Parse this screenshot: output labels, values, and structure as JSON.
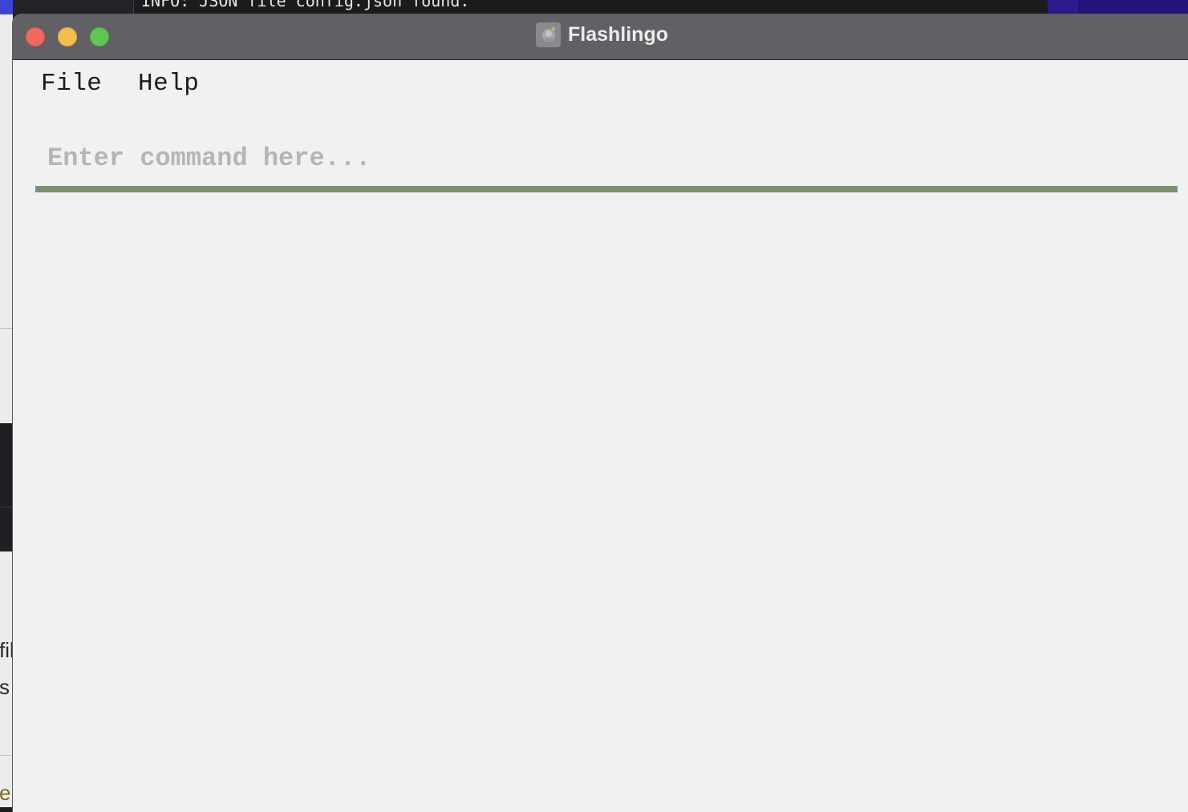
{
  "background": {
    "terminal_line": "INFO: JSON file config.json found.",
    "left_fragments": [
      "fil",
      "s",
      "e"
    ]
  },
  "window": {
    "title": "Flashlingo",
    "app_icon": "flashlingo-app-icon",
    "traffic_lights": {
      "close_color": "#ed6a5e",
      "minimize_color": "#f4be4f",
      "maximize_color": "#61c454"
    }
  },
  "menu": {
    "file_label": "File",
    "help_label": "Help"
  },
  "command": {
    "value": "",
    "placeholder": "Enter command here...",
    "underline_color": "#7e9072"
  }
}
